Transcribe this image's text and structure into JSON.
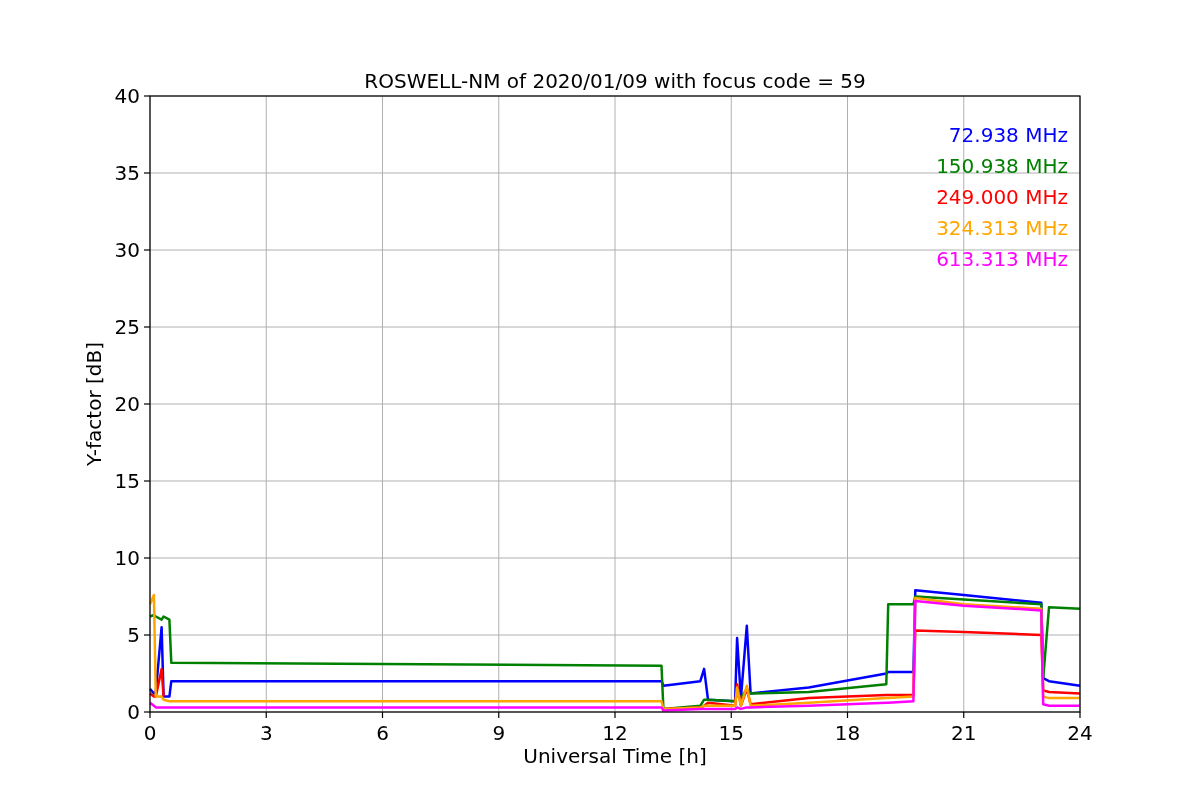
{
  "chart_data": {
    "type": "line",
    "title": "ROSWELL-NM of 2020/01/09 with focus code = 59",
    "xlabel": "Universal Time [h]",
    "ylabel": "Y-factor [dB]",
    "x": [
      0,
      0.1,
      0.15,
      0.3,
      0.35,
      0.5,
      0.55,
      13.2,
      13.25,
      14.2,
      14.3,
      14.4,
      15.1,
      15.15,
      15.25,
      15.4,
      15.5,
      17,
      19,
      19.05,
      19.7,
      19.75,
      21,
      23,
      23.05,
      23.2,
      24
    ],
    "series": [
      {
        "name": "72.938 MHz",
        "color": "#0000ff",
        "values": [
          1.5,
          1.2,
          1.3,
          5.5,
          1.0,
          1.0,
          2.0,
          2.0,
          1.7,
          2.0,
          2.8,
          0.8,
          0.7,
          4.8,
          0.9,
          5.6,
          1.2,
          1.6,
          2.5,
          2.6,
          2.6,
          7.9,
          7.6,
          7.1,
          2.2,
          2.0,
          1.7
        ]
      },
      {
        "name": "150.938 MHz",
        "color": "#008000",
        "values": [
          6.2,
          6.3,
          6.2,
          6.0,
          6.2,
          6.0,
          3.2,
          3.0,
          0.2,
          0.4,
          0.8,
          0.8,
          0.7,
          1.2,
          0.9,
          1.5,
          1.2,
          1.3,
          1.8,
          7.0,
          7.0,
          7.5,
          7.3,
          7.0,
          2.2,
          6.8,
          6.7
        ]
      },
      {
        "name": "249.000 MHz",
        "color": "#ff0000",
        "values": [
          1.2,
          1.0,
          1.0,
          2.8,
          1.0,
          null,
          null,
          null,
          0.2,
          0.3,
          0.4,
          0.6,
          0.4,
          1.8,
          0.4,
          1.5,
          0.5,
          0.9,
          1.1,
          1.1,
          1.1,
          5.3,
          5.2,
          5.0,
          1.4,
          1.3,
          1.2
        ]
      },
      {
        "name": "324.313 MHz",
        "color": "#ffa500",
        "values": [
          7.0,
          7.6,
          1.0,
          1.0,
          0.8,
          0.7,
          0.7,
          0.7,
          0.2,
          0.3,
          0.4,
          0.4,
          0.4,
          1.6,
          0.4,
          1.7,
          0.4,
          0.6,
          0.9,
          0.9,
          1.0,
          7.4,
          7.0,
          6.7,
          1.0,
          0.9,
          0.9
        ]
      },
      {
        "name": "613.313 MHz",
        "color": "#ff00ff",
        "values": [
          0.6,
          0.4,
          0.3,
          0.3,
          0.3,
          0.3,
          0.3,
          0.3,
          0.1,
          0.2,
          0.2,
          0.2,
          0.2,
          0.3,
          0.2,
          0.3,
          0.3,
          0.4,
          0.6,
          0.6,
          0.7,
          7.2,
          6.9,
          6.6,
          0.5,
          0.4,
          0.4
        ]
      }
    ],
    "grid": true,
    "xlim": [
      0,
      24
    ],
    "ylim": [
      0,
      40
    ],
    "xticks": [
      0,
      3,
      6,
      9,
      12,
      15,
      18,
      21,
      24
    ],
    "yticks": [
      0,
      5,
      10,
      15,
      20,
      25,
      30,
      35,
      40
    ]
  }
}
